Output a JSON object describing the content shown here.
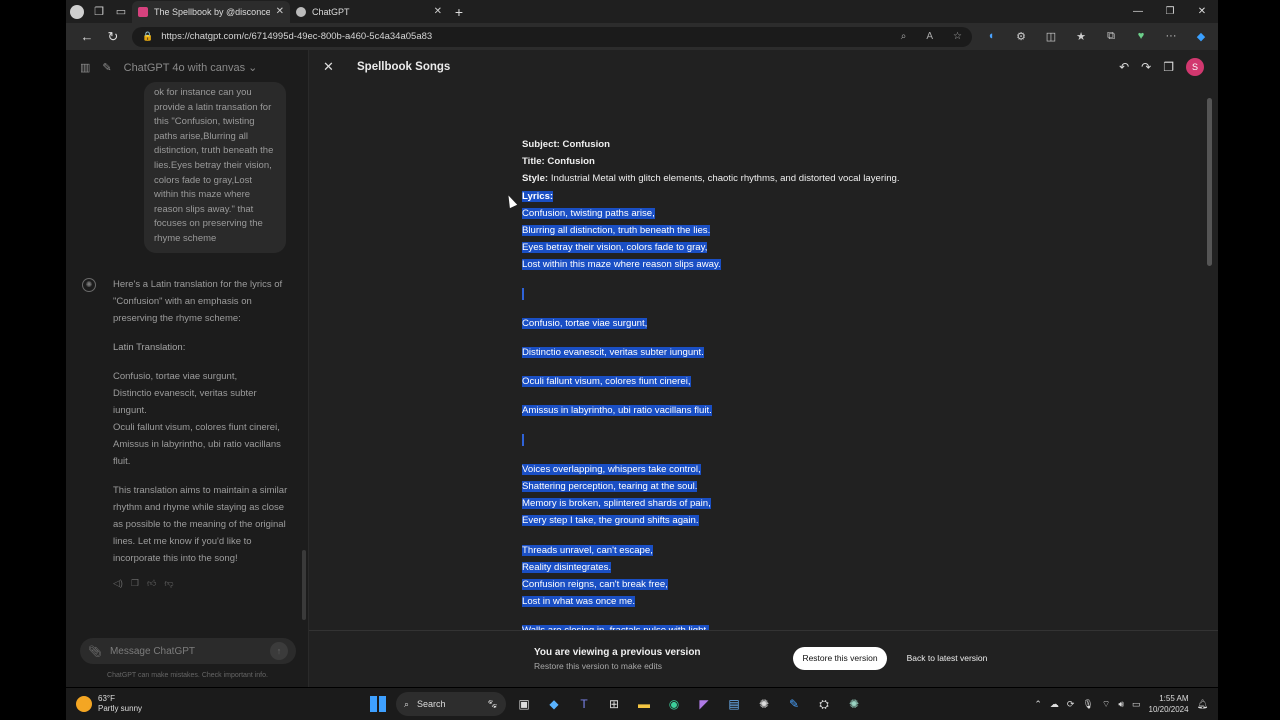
{
  "browser": {
    "tabs": [
      {
        "label": "The Spellbook by @disconcerted",
        "favicon_color": "#d6427e"
      },
      {
        "label": "ChatGPT",
        "favicon_color": "#bbbbbb"
      }
    ],
    "url": "https://chatgpt.com/c/6714995d-49ec-800b-a460-5c4a34a05a83"
  },
  "sidebar": {
    "model_label": "ChatGPT 4o with canvas",
    "user_message": "ok for instance can you provide a latin transation for this \"Confusion, twisting paths arise,Blurring all distinction, truth beneath the lies.Eyes betray their vision, colors fade to gray,Lost within this maze where reason slips away.\" that focuses on preserving the rhyme scheme",
    "assistant": {
      "intro": "Here's a Latin translation for the lyrics of \"Confusion\" with an emphasis on preserving the rhyme scheme:",
      "heading": "Latin Translation:",
      "translation_lines": [
        "Confusio, tortae viae surgunt,",
        "Distinctio evanescit, veritas subter iungunt.",
        "Oculi fallunt visum, colores fiunt cinerei,",
        "Amissus in labyrintho, ubi ratio vacillans fluit."
      ],
      "closing": "This translation aims to maintain a similar rhythm and rhyme while staying as close as possible to the meaning of the original lines. Let me know if you'd like to incorporate this into the song!"
    },
    "composer_placeholder": "Message ChatGPT",
    "disclaimer": "ChatGPT can make mistakes. Check important info."
  },
  "canvas": {
    "title": "Spellbook Songs",
    "avatar_initial": "S",
    "subject_label": "Subject:",
    "subject": "Confusion",
    "title_label": "Title:",
    "song_title": "Confusion",
    "style_label": "Style:",
    "style": "Industrial Metal with glitch elements, chaotic rhythms, and distorted vocal layering.",
    "lyrics_label": "Lyrics:",
    "verse1": [
      "Confusion, twisting paths arise,",
      "Blurring all distinction, truth beneath the lies.",
      "Eyes betray their vision, colors fade to gray,",
      "Lost within this maze where reason slips away."
    ],
    "latin": [
      "Confusio, tortae viae surgunt,",
      "Distinctio evanescit, veritas subter iungunt.",
      "Oculi fallunt visum, colores fiunt cinerei,",
      "Amissus in labyrintho, ubi ratio vacillans fluit."
    ],
    "verse2": [
      "Voices overlapping, whispers take control,",
      "Shattering perception, tearing at the soul.",
      "Memory is broken, splintered shards of pain,",
      "Every step I take, the ground shifts again."
    ],
    "verse3": [
      "Threads unravel, can't escape,",
      "Reality disintegrates.",
      "Confusion reigns, can't break free,",
      "Lost in what was once me."
    ],
    "partial_line": "Walls are closing in, fractals pulse with light,",
    "previous_version": {
      "title": "You are viewing a previous version",
      "subtitle": "Restore this version to make edits",
      "restore_label": "Restore this version",
      "back_label": "Back to latest version"
    }
  },
  "taskbar": {
    "temperature": "63°F",
    "weather": "Partly sunny",
    "search_label": "Search",
    "time": "1:55 AM",
    "date": "10/20/2024"
  }
}
